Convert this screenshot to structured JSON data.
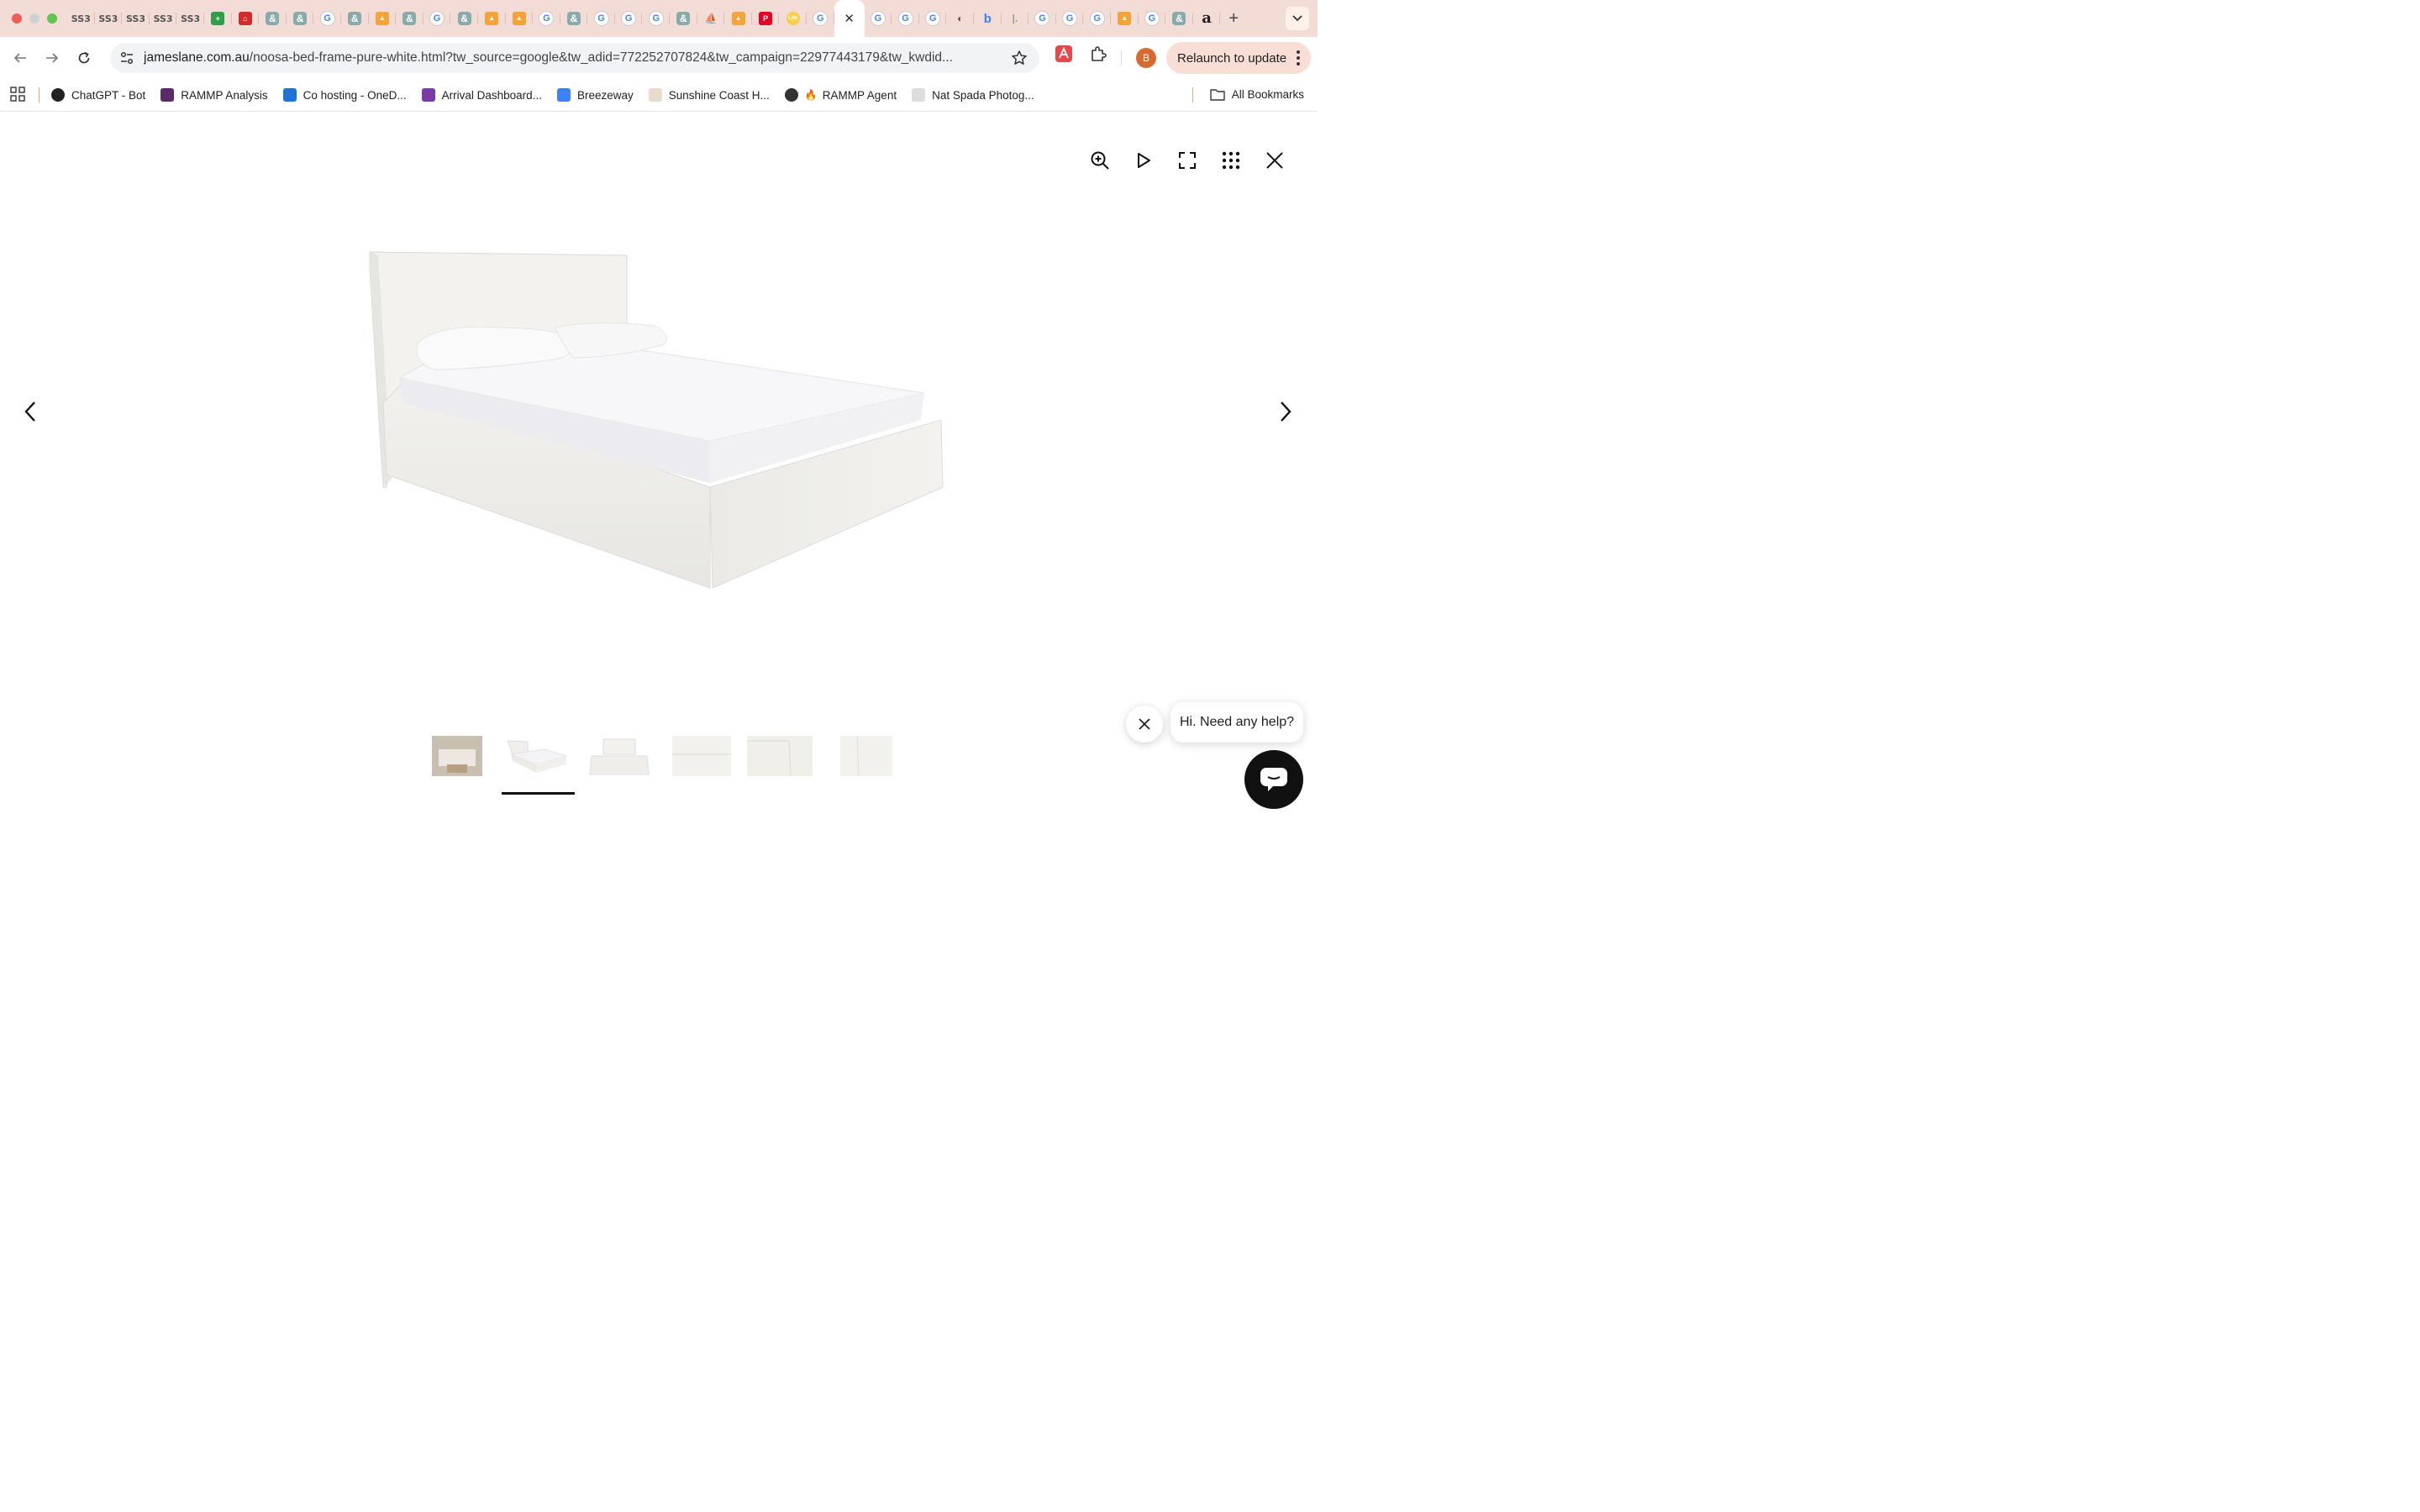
{
  "browser": {
    "tabs": [
      {
        "icon": "ss-icon",
        "glyph": "SS3"
      },
      {
        "icon": "ss-icon",
        "glyph": "SS3"
      },
      {
        "icon": "ss-icon",
        "glyph": "SS3"
      },
      {
        "icon": "ss-icon",
        "glyph": "SS3"
      },
      {
        "icon": "ss-icon",
        "glyph": "SS3"
      },
      {
        "icon": "green-plus-icon",
        "glyph": "+",
        "color": "#2e9e4a"
      },
      {
        "icon": "red-home-icon",
        "glyph": "⌂",
        "color": "#d42a2a"
      },
      {
        "icon": "ampersand-icon",
        "glyph": "&"
      },
      {
        "icon": "ampersand-icon",
        "glyph": "&"
      },
      {
        "icon": "google-icon",
        "glyph": "G"
      },
      {
        "icon": "ampersand-icon",
        "glyph": "&"
      },
      {
        "icon": "shopping-bag-icon",
        "glyph": "▲",
        "color": "#f2a33a"
      },
      {
        "icon": "ampersand-icon",
        "glyph": "&"
      },
      {
        "icon": "google-icon",
        "glyph": "G"
      },
      {
        "icon": "ampersand-icon",
        "glyph": "&"
      },
      {
        "icon": "shopping-bag-icon",
        "glyph": "▲",
        "color": "#f2a33a"
      },
      {
        "icon": "shopping-bag-icon",
        "glyph": "▲",
        "color": "#f2a33a"
      },
      {
        "icon": "google-icon",
        "glyph": "G"
      },
      {
        "icon": "ampersand-icon",
        "glyph": "&"
      },
      {
        "icon": "google-icon",
        "glyph": "G"
      },
      {
        "icon": "google-icon",
        "glyph": "G"
      },
      {
        "icon": "google-icon",
        "glyph": "G"
      },
      {
        "icon": "ampersand-icon",
        "glyph": "&"
      },
      {
        "icon": "sailboat-icon",
        "glyph": "⛵",
        "color": "#777"
      },
      {
        "icon": "shopping-bag-icon",
        "glyph": "▲",
        "color": "#f2a33a"
      },
      {
        "icon": "pinterest-icon",
        "glyph": "P",
        "color": "#e60023"
      },
      {
        "icon": "life-icon",
        "glyph": "Life",
        "color": "#f5d04a"
      },
      {
        "icon": "google-icon",
        "glyph": "G"
      },
      {
        "icon": "close-icon",
        "glyph": "✕",
        "active": true
      },
      {
        "icon": "google-icon",
        "glyph": "G"
      },
      {
        "icon": "google-icon",
        "glyph": "G"
      },
      {
        "icon": "google-icon",
        "glyph": "G"
      },
      {
        "icon": "globe-icon",
        "glyph": "◐",
        "color": "#555"
      },
      {
        "icon": "breezeway-icon",
        "glyph": "b",
        "color": "#3b82f6"
      },
      {
        "icon": "page-icon",
        "glyph": "|.",
        "color": "#999"
      },
      {
        "icon": "google-icon",
        "glyph": "G"
      },
      {
        "icon": "google-icon",
        "glyph": "G"
      },
      {
        "icon": "google-icon",
        "glyph": "G"
      },
      {
        "icon": "shopping-bag-icon",
        "glyph": "▲",
        "color": "#f2a33a"
      },
      {
        "icon": "google-icon",
        "glyph": "G"
      },
      {
        "icon": "ampersand-icon",
        "glyph": "&"
      },
      {
        "icon": "amazon-icon",
        "glyph": "a",
        "color": "#222"
      }
    ],
    "url_domain": "jameslane.com.au",
    "url_path": "/noosa-bed-frame-pure-white.html?tw_source=google&tw_adid=772252707824&tw_campaign=22977443179&tw_kwdid...",
    "profile_initial": "B",
    "relaunch_label": "Relaunch to update",
    "colors": {
      "tabstrip": "#f3dcd5",
      "relaunch": "#f8ded4",
      "profile": "#d9692e"
    }
  },
  "bookmarks": {
    "items": [
      {
        "label": "ChatGPT - Bot",
        "icon": "chatgpt-icon"
      },
      {
        "label": "RAMMP Analysis",
        "icon": "rammp-icon"
      },
      {
        "label": "Co hosting - OneD...",
        "icon": "onedrive-icon"
      },
      {
        "label": "Arrival Dashboard...",
        "icon": "arrival-icon"
      },
      {
        "label": "Breezeway",
        "icon": "breezeway-icon"
      },
      {
        "label": "Sunshine Coast H...",
        "icon": "sunshine-icon"
      },
      {
        "label": "RAMMP Agent",
        "icon": "globe-fire-icon",
        "prefix": "🔥"
      },
      {
        "label": "Nat Spada Photog...",
        "icon": "page-icon"
      }
    ],
    "all_label": "All Bookmarks"
  },
  "viewer": {
    "controls": [
      "zoom-in-icon",
      "play-icon",
      "fullscreen-icon",
      "grid-icon",
      "close-icon"
    ],
    "thumbnails_count": 6,
    "active_thumbnail": 2
  },
  "chat": {
    "bubble_text": "Hi. Need any help?"
  }
}
